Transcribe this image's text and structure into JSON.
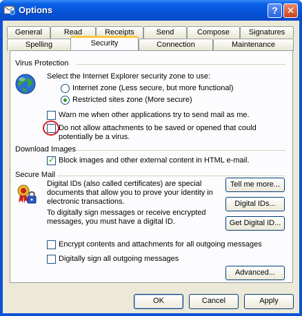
{
  "window": {
    "title": "Options",
    "help_label": "?",
    "close_label": "✕"
  },
  "tabs_row1": [
    "General",
    "Read",
    "Receipts",
    "Send",
    "Compose",
    "Signatures"
  ],
  "tabs_row2": [
    "Spelling",
    "Security",
    "Connection",
    "Maintenance"
  ],
  "active_tab": "Security",
  "virus": {
    "group_title": "Virus Protection",
    "zone_prompt": "Select the Internet Explorer security zone to use:",
    "zone_internet": "Internet zone (Less secure, but more functional)",
    "zone_restricted": "Restricted sites zone (More secure)",
    "selected_zone": "restricted",
    "warn_label": "Warn me when other applications try to send mail as me.",
    "warn_checked": false,
    "attach_line1": "Do not allow attachments to be saved or opened that could",
    "attach_line2": "potentially be a virus.",
    "attach_checked": false
  },
  "download": {
    "group_title": "Download Images",
    "block_label": "Block images and other external content in HTML e-mail.",
    "block_checked": true
  },
  "secure": {
    "group_title": "Secure Mail",
    "ids_line1": "Digital IDs (also called certificates) are special",
    "ids_line2": "documents that allow you to prove your identity in",
    "ids_line3": "electronic transactions.",
    "sign_line1": "To digitally sign messages or receive encrypted",
    "sign_line2": "messages, you must have a digital ID.",
    "tell_me_label": "Tell me more...",
    "digital_ids_label": "Digital IDs...",
    "get_id_label": "Get Digital ID...",
    "encrypt_label": "Encrypt contents and attachments for all outgoing messages",
    "encrypt_checked": false,
    "sign_label": "Digitally sign all outgoing messages",
    "sign_checked": false,
    "advanced_label": "Advanced..."
  },
  "footer": {
    "ok_label": "OK",
    "cancel_label": "Cancel",
    "apply_label": "Apply"
  }
}
